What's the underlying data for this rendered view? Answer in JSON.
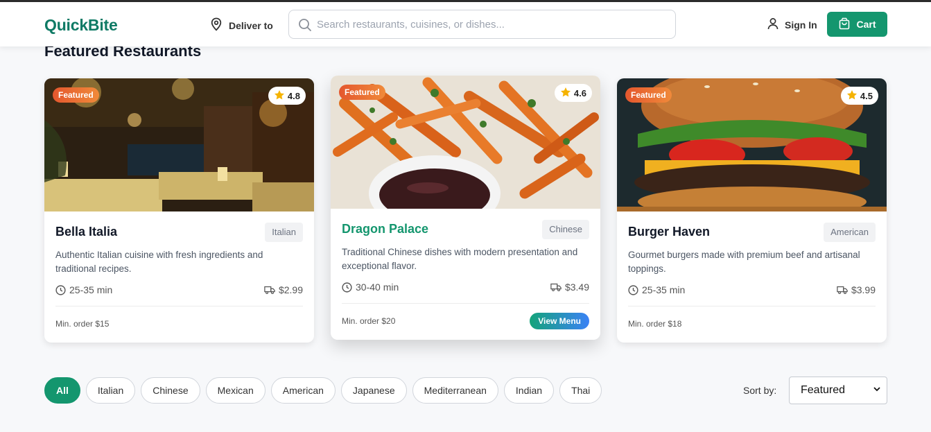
{
  "header": {
    "logo": "QuickBite",
    "deliver_label": "Deliver to",
    "search_placeholder": "Search restaurants, cuisines, or dishes...",
    "signin_label": "Sign In",
    "cart_label": "Cart"
  },
  "section": {
    "title": "Featured Restaurants"
  },
  "restaurants": [
    {
      "name": "Bella Italia",
      "cuisine": "Italian",
      "rating": "4.8",
      "badge": "Featured",
      "description": "Authentic Italian cuisine with fresh ingredients and traditional recipes.",
      "delivery_time": "25-35 min",
      "delivery_fee": "$2.99",
      "min_order": "Min. order $15"
    },
    {
      "name": "Dragon Palace",
      "cuisine": "Chinese",
      "rating": "4.6",
      "badge": "Featured",
      "description": "Traditional Chinese dishes with modern presentation and exceptional flavor.",
      "delivery_time": "30-40 min",
      "delivery_fee": "$3.49",
      "min_order": "Min. order $20",
      "action_label": "View Menu"
    },
    {
      "name": "Burger Haven",
      "cuisine": "American",
      "rating": "4.5",
      "badge": "Featured",
      "description": "Gourmet burgers made with premium beef and artisanal toppings.",
      "delivery_time": "25-35 min",
      "delivery_fee": "$3.99",
      "min_order": "Min. order $18"
    }
  ],
  "filters": [
    "All",
    "Italian",
    "Chinese",
    "Mexican",
    "American",
    "Japanese",
    "Mediterranean",
    "Indian",
    "Thai"
  ],
  "sort": {
    "label": "Sort by:",
    "selected": "Featured"
  },
  "colors": {
    "brand": "#14966e",
    "logo": "#0f7a65",
    "badge": "#e4572e",
    "star": "#f5b301"
  }
}
